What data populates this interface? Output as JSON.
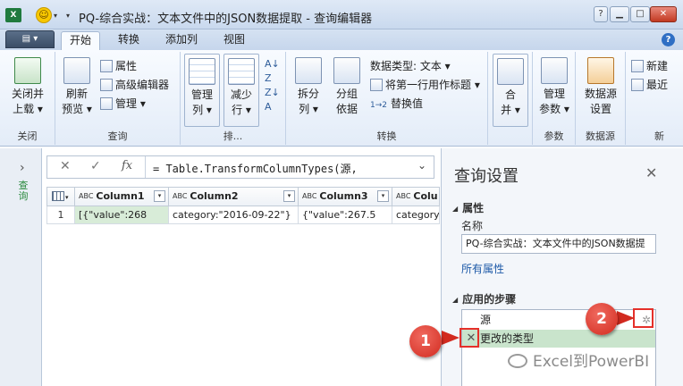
{
  "window": {
    "app_icon": "excel-icon",
    "title": "PQ-综合实战：文本文件中的JSON数据提取 - 查询编辑器",
    "help_symbol": "?",
    "min_symbol": "▁",
    "max_symbol": "□",
    "close_symbol": "✕"
  },
  "ribbon_tabs": {
    "file": "▤ ▾",
    "tabs": [
      "开始",
      "转换",
      "添加列",
      "视图"
    ],
    "help": "?"
  },
  "ribbon": {
    "close_group": {
      "button": "关闭并\n上载 ▾",
      "label": "关闭"
    },
    "query_group": {
      "refresh": "刷新\n预览 ▾",
      "properties": "属性",
      "advanced_editor": "高级编辑器",
      "manage": "管理 ▾",
      "label": "查询"
    },
    "cols_group": {
      "manage_cols": "管理\n列 ▾",
      "reduce_rows": "减少\n行 ▾",
      "sort_label": "排..."
    },
    "transform_group": {
      "split": "拆分\n列 ▾",
      "group_by": "分组\n依据",
      "data_type": "数据类型: 文本 ▾",
      "first_row": "将第一行用作标题 ▾",
      "replace": "替换值",
      "label": "转换"
    },
    "merge_group": {
      "merge": "合\n并 ▾"
    },
    "params_group": {
      "manage_params": "管理\n参数 ▾",
      "label": "参数"
    },
    "datasource_group": {
      "settings": "数据源\n设置",
      "label": "数据源"
    },
    "new_group": {
      "new_source": "新建",
      "recent": "最近",
      "label": "新"
    }
  },
  "left_pane": {
    "chevron": "›",
    "label": "查询"
  },
  "formula_bar": {
    "cancel": "✕",
    "confirm": "✓",
    "fx": "fx",
    "formula": "= Table.TransformColumnTypes(源,",
    "expand": "⌄"
  },
  "table": {
    "columns": [
      {
        "type": "ABC",
        "name": "Column1"
      },
      {
        "type": "ABC",
        "name": "Column2"
      },
      {
        "type": "ABC",
        "name": "Column3"
      },
      {
        "type": "ABC",
        "name": "Colu"
      }
    ],
    "rows": [
      {
        "num": "1",
        "cells": [
          "[{\"value\":268",
          "category:\"2016-09-22\"}",
          "{\"value\":267.5",
          "category"
        ]
      }
    ]
  },
  "query_settings": {
    "title": "查询设置",
    "close": "✕",
    "properties_header": "属性",
    "name_label": "名称",
    "name_value": "PQ-综合实战：文本文件中的JSON数据提",
    "all_properties": "所有属性",
    "applied_steps_header": "应用的步骤",
    "steps": [
      "源",
      "更改的类型"
    ],
    "gear_symbol": "✲",
    "delete_symbol": "✕"
  },
  "annotations": {
    "callout_1": "1",
    "callout_2": "2"
  },
  "watermark": "Excel到PowerBI",
  "colors": {
    "accent_red": "#e5302a",
    "selected_step": "#c9e4cc",
    "link": "#1e5aa8"
  }
}
